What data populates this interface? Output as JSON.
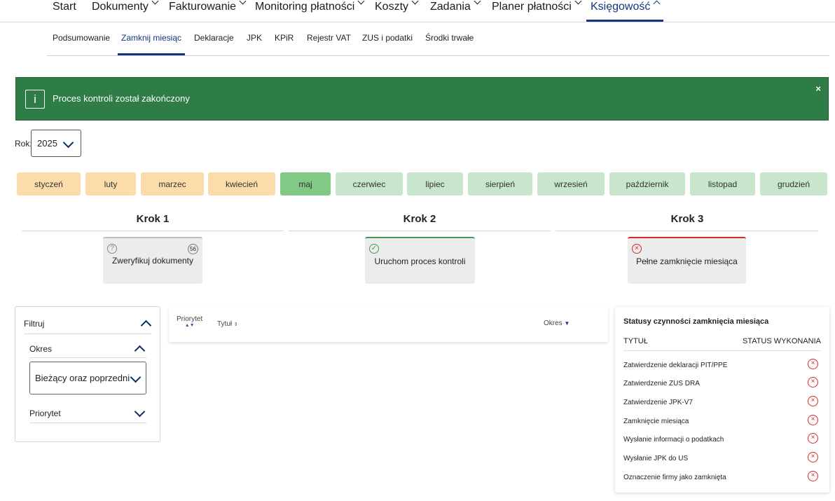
{
  "topnav": [
    {
      "label": "Start",
      "active": false,
      "chev": false
    },
    {
      "label": "Dokumenty",
      "active": false,
      "chev": true
    },
    {
      "label": "Fakturowanie",
      "active": false,
      "chev": true
    },
    {
      "label": "Monitoring płatności",
      "active": false,
      "chev": true
    },
    {
      "label": "Koszty",
      "active": false,
      "chev": true
    },
    {
      "label": "Zadania",
      "active": false,
      "chev": true
    },
    {
      "label": "Planer płatności",
      "active": false,
      "chev": true
    },
    {
      "label": "Księgowość",
      "active": true,
      "chev": true
    }
  ],
  "subnav": [
    "Podsumowanie",
    "Zamknij miesiąc",
    "Deklaracje",
    "JPK",
    "KPiR",
    "Rejestr VAT",
    "ZUS i podatki",
    "Środki trwałe"
  ],
  "subnav_active": "Zamknij miesiąc",
  "alert": {
    "icon": "info-icon",
    "message": "Proces kontroli został zakończony",
    "close": "×"
  },
  "year": {
    "label": "Rok:",
    "value": "2025"
  },
  "months": [
    {
      "label": "styczeń",
      "state": "past"
    },
    {
      "label": "luty",
      "state": "past"
    },
    {
      "label": "marzec",
      "state": "past"
    },
    {
      "label": "kwiecień",
      "state": "past"
    },
    {
      "label": "maj",
      "state": "current"
    },
    {
      "label": "czerwiec",
      "state": "future"
    },
    {
      "label": "lipiec",
      "state": "future"
    },
    {
      "label": "sierpień",
      "state": "future"
    },
    {
      "label": "wrzesień",
      "state": "future"
    },
    {
      "label": "październik",
      "state": "future"
    },
    {
      "label": "listopad",
      "state": "future"
    },
    {
      "label": "grudzień",
      "state": "future"
    }
  ],
  "steps": [
    {
      "title": "Krok 1",
      "card": "Zweryfikuj dokumenty",
      "icon": "question-icon",
      "badge": "56",
      "status": "pending"
    },
    {
      "title": "Krok 2",
      "card": "Uruchom proces kontroli",
      "icon": "check-icon",
      "status": "done"
    },
    {
      "title": "Krok 3",
      "card": "Pełne zamknięcie miesiąca",
      "icon": "error-icon",
      "status": "error"
    }
  ],
  "filter": {
    "title": "Filtruj",
    "okres_label": "Okres",
    "okres_value": "Bieżący oraz poprzedni",
    "priorytet_label": "Priorytet"
  },
  "table": {
    "col_priority": "Priorytet",
    "col_title": "Tytuł",
    "col_period": "Okres"
  },
  "status_panel": {
    "title": "Statusy czynności zamknięcia miesiąca",
    "col_title": "TYTUŁ",
    "col_status": "STATUS WYKONANIA",
    "rows": [
      "Zatwierdzenie deklaracji PIT/PPE",
      "Zatwierdzenie ZUS DRA",
      "Zatwierdzenie JPK-V7",
      "Zamknięcie miesiąca",
      "Wysłanie informacji o podatkach",
      "Wysłanie JPK do US",
      "Oznaczenie firmy jako zamknięta"
    ]
  },
  "colors": {
    "brand": "#14357a",
    "alert_bg": "#2e7d46",
    "month_past": "#fddcab",
    "month_current": "#82c886",
    "month_future": "#c8e6cb",
    "error": "#d42a2a",
    "success": "#3e9e51"
  }
}
